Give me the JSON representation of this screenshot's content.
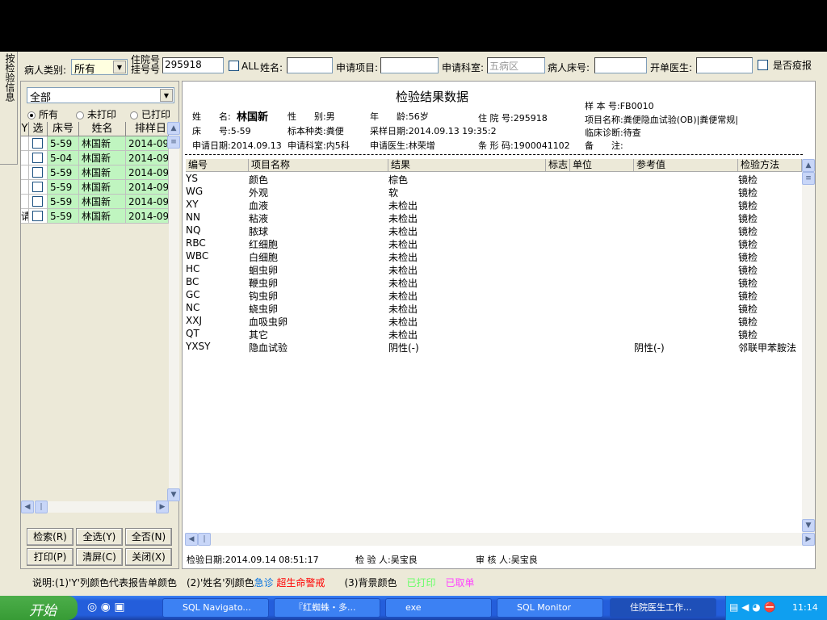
{
  "side_tab": "按检验信息",
  "filters": {
    "patient_type_label": "病人类别:",
    "patient_type_value": "所有",
    "hosp_no_label1": "住院号",
    "hosp_no_label2": "挂号号",
    "hosp_no_value": "295918",
    "all_label": "ALL",
    "name_label": "姓名:",
    "name_value": "",
    "item_label": "申请项目:",
    "item_value": "",
    "dept_label": "申请科室:",
    "dept_value": "五病区",
    "bed_label": "病人床号:",
    "bed_value": "",
    "doctor_label": "开单医生:",
    "doctor_value": "",
    "epidemic_label": "是否疫报"
  },
  "left": {
    "filter_value": "全部",
    "radios": [
      "所有",
      "未打印",
      "已打印"
    ],
    "columns": [
      "Y",
      "选",
      "床号",
      "姓名",
      "排样日"
    ],
    "rows": [
      {
        "y": "",
        "bed": "5-59",
        "name": "林国新",
        "date": "2014-09"
      },
      {
        "y": "",
        "bed": "5-04",
        "name": "林国新",
        "date": "2014-09"
      },
      {
        "y": "",
        "bed": "5-59",
        "name": "林国新",
        "date": "2014-09"
      },
      {
        "y": "",
        "bed": "5-59",
        "name": "林国新",
        "date": "2014-09"
      },
      {
        "y": "",
        "bed": "5-59",
        "name": "林国新",
        "date": "2014-09"
      },
      {
        "y": "请",
        "bed": "5-59",
        "name": "林国新",
        "date": "2014-09"
      }
    ],
    "buttons": [
      "检索(R)",
      "全选(Y)",
      "全否(N)",
      "打印(P)",
      "清屏(C)",
      "关闭(X)"
    ]
  },
  "report": {
    "title": "检验结果数据",
    "name_label": "姓　　名:",
    "name": "林国新",
    "sex": "性　　别:男",
    "age": "年　　龄:56岁",
    "hosp_no": "住 院 号:295918",
    "bed": "床　　号:5-59",
    "sample_type": "标本种类:粪便",
    "sample_date": "采样日期:2014.09.13 19:35:2",
    "apply_date": "申请日期:2014.09.13",
    "apply_dept": "申请科室:内5科",
    "apply_doctor": "申请医生:林荣增",
    "barcode": "条 形 码:1900041102",
    "sample_no": "样 本 号:FB0010",
    "item_name": "项目名称:粪便隐血试验(OB)|粪便常规|",
    "diagnosis": "临床诊断:待查",
    "remark": "备　　注:",
    "columns": [
      "编号",
      "项目名称",
      "结果",
      "标志",
      "单位",
      "参考值",
      "检验方法"
    ],
    "rows": [
      [
        "YS",
        "颜色",
        "棕色",
        "",
        "",
        "",
        "镜检"
      ],
      [
        "WG",
        "外观",
        "软",
        "",
        "",
        "",
        "镜检"
      ],
      [
        "XY",
        "血液",
        "未检出",
        "",
        "",
        "",
        "镜检"
      ],
      [
        "NN",
        "粘液",
        "未检出",
        "",
        "",
        "",
        "镜检"
      ],
      [
        "NQ",
        "脓球",
        "未检出",
        "",
        "",
        "",
        "镜检"
      ],
      [
        "RBC",
        "红细胞",
        "未检出",
        "",
        "",
        "",
        "镜检"
      ],
      [
        "WBC",
        "白细胞",
        "未检出",
        "",
        "",
        "",
        "镜检"
      ],
      [
        "HC",
        "蛔虫卵",
        "未检出",
        "",
        "",
        "",
        "镜检"
      ],
      [
        "BC",
        "鞭虫卵",
        "未检出",
        "",
        "",
        "",
        "镜检"
      ],
      [
        "GC",
        "钩虫卵",
        "未检出",
        "",
        "",
        "",
        "镜检"
      ],
      [
        "NC",
        "蛲虫卵",
        "未检出",
        "",
        "",
        "",
        "镜检"
      ],
      [
        "XXJ",
        "血吸虫卵",
        "未检出",
        "",
        "",
        "",
        "镜检"
      ],
      [
        "QT",
        "其它",
        "未检出",
        "",
        "",
        "",
        "镜检"
      ],
      [
        "YXSY",
        "隐血试验",
        "阴性(-)",
        "",
        "",
        "阴性(-)",
        "邻联甲苯胺法"
      ]
    ],
    "test_date": "检验日期:2014.09.14 08:51:17",
    "tester": "检 验 人:吴宝良",
    "reviewer": "审 核 人:吴宝良"
  },
  "legend": {
    "p1": "说明:(1)'Y'列颜色代表报告单颜色　(2)'姓名'列颜色",
    "urgent": "急诊",
    "critical": "超生命警戒",
    "p3": "(3)背景颜色",
    "printed": "已打印",
    "cancelled": "已取单"
  },
  "colors": {
    "urgent": "#0070e0",
    "critical": "#ff0000",
    "printed": "#66ff66",
    "cancelled": "#ff44ff",
    "row_bg": "#c0f5c0"
  },
  "taskbar": {
    "start": "开始",
    "items": [
      "SQL Navigato...",
      "『红蜘蛛・多...",
      "exe",
      "SQL Monitor",
      "住院医生工作..."
    ],
    "clock": "11:14"
  }
}
